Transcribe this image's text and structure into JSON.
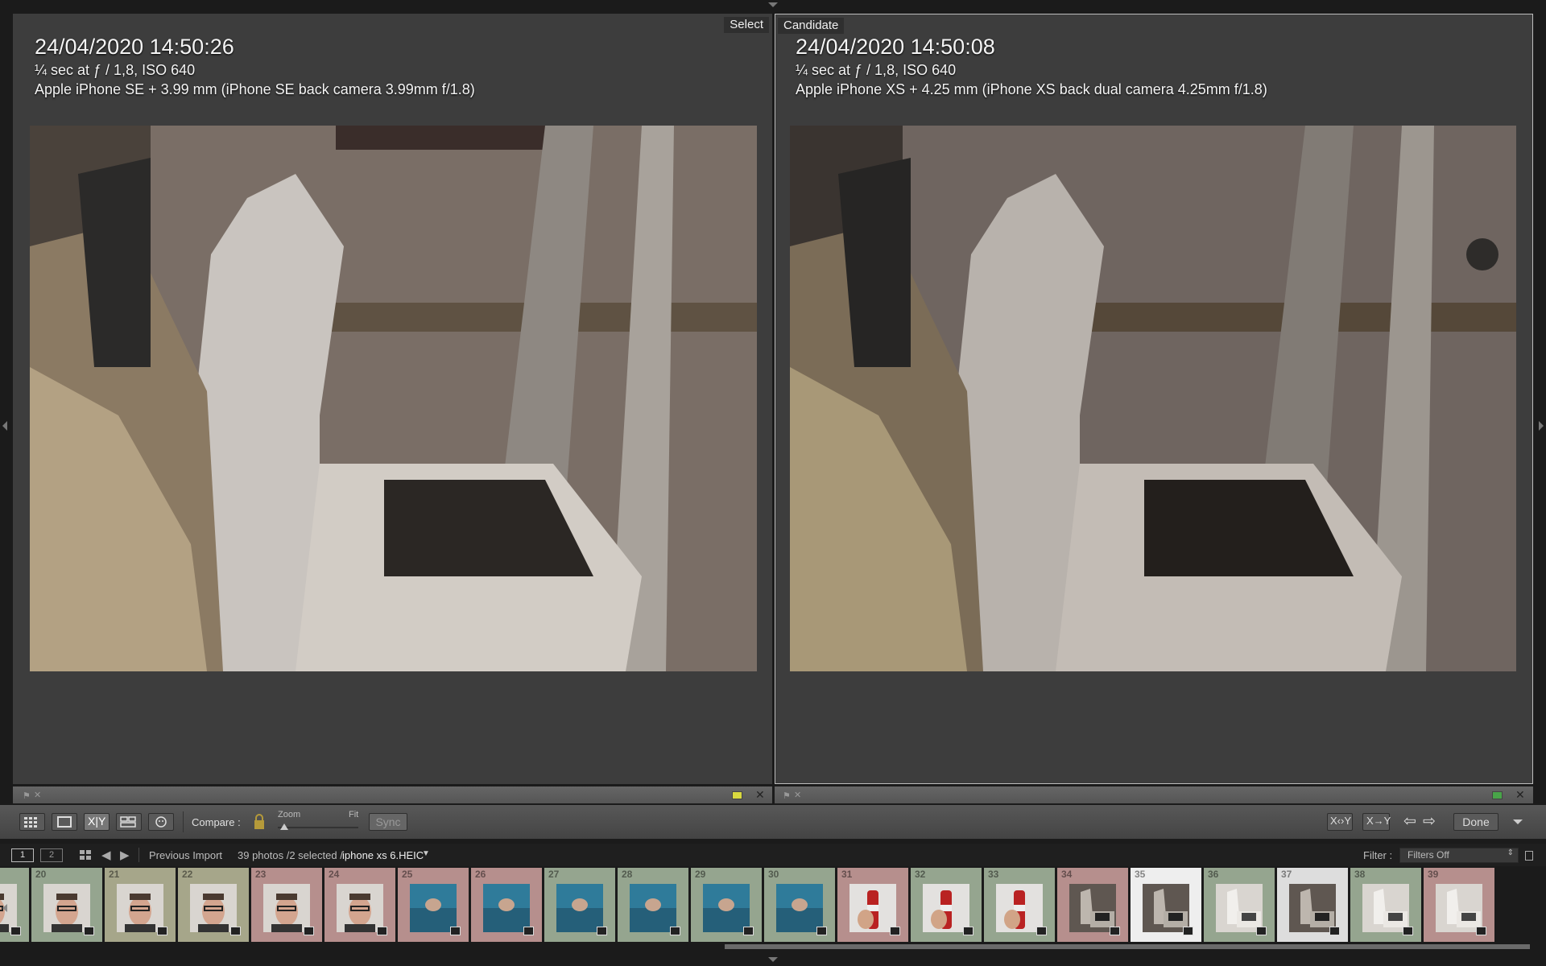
{
  "left_pane": {
    "label": "Select",
    "datetime": "24/04/2020 14:50:26",
    "exposure": "¼ sec at ƒ / 1,8, ISO 640",
    "camera": "Apple iPhone SE + 3.99 mm (iPhone SE back camera 3.99mm f/1.8)"
  },
  "right_pane": {
    "label": "Candidate",
    "datetime": "24/04/2020 14:50:08",
    "exposure": "¼ sec at ƒ / 1,8, ISO 640",
    "camera": "Apple iPhone XS + 4.25 mm (iPhone XS back dual camera 4.25mm f/1.8)"
  },
  "toolbar": {
    "compare_label": "Compare :",
    "zoom_label": "Zoom",
    "fit_label": "Fit",
    "sync_label": "Sync",
    "done_label": "Done"
  },
  "filmstrip_header": {
    "screen1": "1",
    "screen2": "2",
    "source": "Previous Import",
    "count_prefix": "39 photos /2 selected /",
    "current_file": "iphone xs 6.HEIC",
    "filter_label": "Filter :",
    "filter_value": "Filters Off"
  },
  "colors": {
    "red_label": "#b68f8d",
    "green_label": "#95a58f",
    "yellow_label": "#a6a68a",
    "candidate_flag": "#49a449",
    "select_flag": "#d8d83f"
  },
  "filmstrip": [
    {
      "num": "",
      "bg": "#95a58f",
      "kind": "face"
    },
    {
      "num": "20",
      "bg": "#95a58f",
      "kind": "face"
    },
    {
      "num": "21",
      "bg": "#a6a68a",
      "kind": "face"
    },
    {
      "num": "22",
      "bg": "#a6a68a",
      "kind": "face"
    },
    {
      "num": "23",
      "bg": "#b68f8d",
      "kind": "face"
    },
    {
      "num": "24",
      "bg": "#b68f8d",
      "kind": "face"
    },
    {
      "num": "25",
      "bg": "#b68f8d",
      "kind": "blue"
    },
    {
      "num": "26",
      "bg": "#b68f8d",
      "kind": "blue"
    },
    {
      "num": "27",
      "bg": "#95a58f",
      "kind": "blue"
    },
    {
      "num": "28",
      "bg": "#95a58f",
      "kind": "blue"
    },
    {
      "num": "29",
      "bg": "#95a58f",
      "kind": "blue"
    },
    {
      "num": "30",
      "bg": "#95a58f",
      "kind": "blue"
    },
    {
      "num": "31",
      "bg": "#b68f8d",
      "kind": "bottle"
    },
    {
      "num": "32",
      "bg": "#95a58f",
      "kind": "bottle"
    },
    {
      "num": "33",
      "bg": "#95a58f",
      "kind": "bottle"
    },
    {
      "num": "34",
      "bg": "#b68f8d",
      "kind": "washer"
    },
    {
      "num": "35",
      "bg": "#eeeeee",
      "kind": "washer"
    },
    {
      "num": "36",
      "bg": "#95a58f",
      "kind": "washer-light"
    },
    {
      "num": "37",
      "bg": "#dddddd",
      "kind": "washer"
    },
    {
      "num": "38",
      "bg": "#95a58f",
      "kind": "washer-light"
    },
    {
      "num": "39",
      "bg": "#b68f8d",
      "kind": "washer-light"
    }
  ]
}
